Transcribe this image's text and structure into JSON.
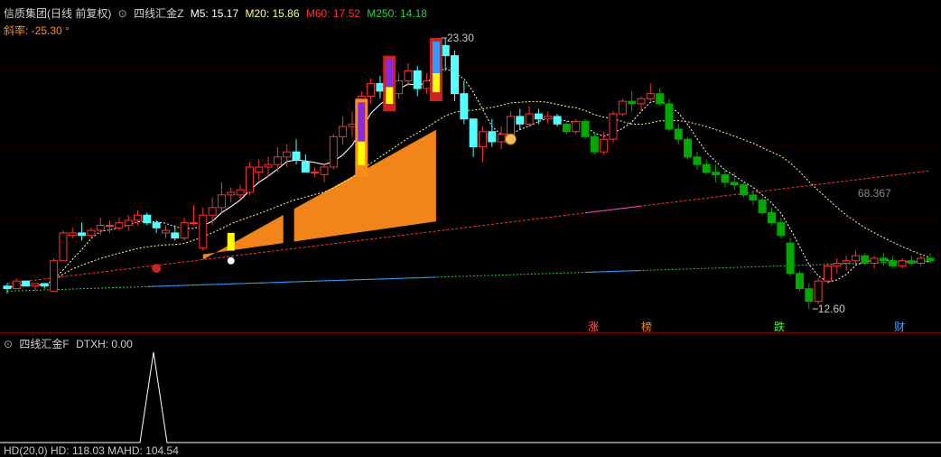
{
  "header": {
    "stock_title": "信质集团(日线 前复权)",
    "indicator_name": "四线汇金Z",
    "ma5_label": "M5: 15.17",
    "ma20_label": "M20: 15.86",
    "ma60_label": "M60: 17.52",
    "ma250_label": "M250: 14.18",
    "slope_label": "斜率: -25.30 °"
  },
  "sub_header": {
    "indicator_name": "四线汇金F",
    "dtxh_label": "DTXH: 0.00",
    "bottom_cut_text": "HD(20,0) HD: 118.03 MAHD: 104.54"
  },
  "annotations": {
    "high_label": "23.30",
    "low_label": "12.60",
    "ma_label": "68.367"
  },
  "signals": [
    "涨",
    "榜",
    "跌",
    "财"
  ],
  "colors": {
    "up": "#ff3232",
    "down": "#54ffff",
    "flat_down": "#00a800",
    "ma5": "#ffffff",
    "ma20": "#ffff80",
    "ma60": "#ff3232",
    "ma250": "#2ecc40",
    "accent_orange": "#ff8c1a",
    "slope_text": "#ff8c1a"
  },
  "chart_data": [
    {
      "type": "candlestick",
      "title": "四线汇金Z",
      "price_range": [
        12.6,
        23.3
      ],
      "series": [
        {
          "name": "M5",
          "value": 15.17
        },
        {
          "name": "M20",
          "value": 15.86
        },
        {
          "name": "M60",
          "value": 17.52
        },
        {
          "name": "M250",
          "value": 14.18
        }
      ],
      "ohlc": [
        [
          13.5,
          13.6,
          13.2,
          13.4
        ],
        [
          13.4,
          13.8,
          13.4,
          13.7
        ],
        [
          13.7,
          13.7,
          13.5,
          13.5
        ],
        [
          13.5,
          13.6,
          13.3,
          13.6
        ],
        [
          13.6,
          13.6,
          13.4,
          13.5
        ],
        [
          13.3,
          14.6,
          13.3,
          14.5
        ],
        [
          14.5,
          15.7,
          14.5,
          15.6
        ],
        [
          15.5,
          15.8,
          15.4,
          15.6
        ],
        [
          15.6,
          16.0,
          15.3,
          15.5
        ],
        [
          15.5,
          15.8,
          15.4,
          15.7
        ],
        [
          15.7,
          16.2,
          15.5,
          15.9
        ],
        [
          15.9,
          16.1,
          15.6,
          15.9
        ],
        [
          15.8,
          16.2,
          15.7,
          16.0
        ],
        [
          15.9,
          16.3,
          15.7,
          16.1
        ],
        [
          16.1,
          16.5,
          15.9,
          16.3
        ],
        [
          16.3,
          16.4,
          15.9,
          16.0
        ],
        [
          16.0,
          16.1,
          15.6,
          15.8
        ],
        [
          15.6,
          15.9,
          15.4,
          15.7
        ],
        [
          15.6,
          15.9,
          15.3,
          15.4
        ],
        [
          15.4,
          16.2,
          15.3,
          16.0
        ],
        [
          16.0,
          16.7,
          15.9,
          16.0
        ],
        [
          15.0,
          16.6,
          14.9,
          16.3
        ],
        [
          16.3,
          17.0,
          15.9,
          16.6
        ],
        [
          16.6,
          17.6,
          16.4,
          17.1
        ],
        [
          17.1,
          17.4,
          16.8,
          17.2
        ],
        [
          17.1,
          17.5,
          16.9,
          17.3
        ],
        [
          17.2,
          18.4,
          17.1,
          18.2
        ],
        [
          18.0,
          18.5,
          17.7,
          18.2
        ],
        [
          18.2,
          18.6,
          17.8,
          18.3
        ],
        [
          18.3,
          19.0,
          18.0,
          18.6
        ],
        [
          18.6,
          19.1,
          18.2,
          18.8
        ],
        [
          18.8,
          19.3,
          18.3,
          18.5
        ],
        [
          18.4,
          18.7,
          18.0,
          18.0
        ],
        [
          18.0,
          18.2,
          17.8,
          18.0
        ],
        [
          17.9,
          18.3,
          17.6,
          18.2
        ],
        [
          18.2,
          19.5,
          18.1,
          19.4
        ],
        [
          19.4,
          20.2,
          19.1,
          19.8
        ],
        [
          19.8,
          20.4,
          19.4,
          19.9
        ],
        [
          19.9,
          21.2,
          19.8,
          21.0
        ],
        [
          21.0,
          21.7,
          20.7,
          21.5
        ],
        [
          21.5,
          21.8,
          20.9,
          21.2
        ],
        [
          21.2,
          21.5,
          20.7,
          21.1
        ],
        [
          21.1,
          21.9,
          20.9,
          21.6
        ],
        [
          21.6,
          22.3,
          21.4,
          22.0
        ],
        [
          22.0,
          22.2,
          21.0,
          21.3
        ],
        [
          21.3,
          21.9,
          21.1,
          21.6
        ],
        [
          21.6,
          23.3,
          21.5,
          23.0
        ],
        [
          23.0,
          23.3,
          22.0,
          22.6
        ],
        [
          22.6,
          22.8,
          20.8,
          21.1
        ],
        [
          21.1,
          21.6,
          19.9,
          20.1
        ],
        [
          20.1,
          20.1,
          18.6,
          19.0
        ],
        [
          19.0,
          19.8,
          18.4,
          19.6
        ],
        [
          19.6,
          20.1,
          19.0,
          19.2
        ],
        [
          19.2,
          19.8,
          18.9,
          19.5
        ],
        [
          19.5,
          20.4,
          19.4,
          20.2
        ],
        [
          20.2,
          20.5,
          19.7,
          19.9
        ],
        [
          19.9,
          20.6,
          19.8,
          20.3
        ],
        [
          20.3,
          20.5,
          19.9,
          20.1
        ],
        [
          20.1,
          20.4,
          19.9,
          20.2
        ],
        [
          20.2,
          20.3,
          19.8,
          19.9
        ],
        [
          19.9,
          20.0,
          19.5,
          19.6
        ],
        [
          19.6,
          20.1,
          19.5,
          20.0
        ],
        [
          20.0,
          20.1,
          19.3,
          19.4
        ],
        [
          19.4,
          19.6,
          18.7,
          18.8
        ],
        [
          18.8,
          19.6,
          18.7,
          19.3
        ],
        [
          19.3,
          20.4,
          19.2,
          20.3
        ],
        [
          20.3,
          20.9,
          20.2,
          20.8
        ],
        [
          20.8,
          21.2,
          20.4,
          20.7
        ],
        [
          20.7,
          21.0,
          20.4,
          20.9
        ],
        [
          20.9,
          21.5,
          20.8,
          21.1
        ],
        [
          21.1,
          21.3,
          20.6,
          20.7
        ],
        [
          20.7,
          20.9,
          19.6,
          19.7
        ],
        [
          19.7,
          19.9,
          19.1,
          19.3
        ],
        [
          19.3,
          19.4,
          18.5,
          18.6
        ],
        [
          18.6,
          18.8,
          18.1,
          18.3
        ],
        [
          18.3,
          18.5,
          17.9,
          18.0
        ],
        [
          18.0,
          18.3,
          17.6,
          17.9
        ],
        [
          17.9,
          18.1,
          17.4,
          17.6
        ],
        [
          17.6,
          18.0,
          17.3,
          17.5
        ],
        [
          17.5,
          17.6,
          17.0,
          17.1
        ],
        [
          17.1,
          17.3,
          16.7,
          16.9
        ],
        [
          16.9,
          17.0,
          16.3,
          16.4
        ],
        [
          16.4,
          16.6,
          15.9,
          16.0
        ],
        [
          16.0,
          16.2,
          15.4,
          15.5
        ],
        [
          15.2,
          15.4,
          13.9,
          14.0
        ],
        [
          14.0,
          14.1,
          13.3,
          13.4
        ],
        [
          13.4,
          13.6,
          12.6,
          12.9
        ],
        [
          12.9,
          13.8,
          12.8,
          13.7
        ],
        [
          13.7,
          14.4,
          13.6,
          14.3
        ],
        [
          14.3,
          14.6,
          14.0,
          14.4
        ],
        [
          14.4,
          14.7,
          14.1,
          14.5
        ],
        [
          14.5,
          14.9,
          14.3,
          14.7
        ],
        [
          14.7,
          14.8,
          14.3,
          14.4
        ],
        [
          14.4,
          14.7,
          14.2,
          14.6
        ],
        [
          14.6,
          14.8,
          14.3,
          14.5
        ],
        [
          14.5,
          14.7,
          14.2,
          14.3
        ],
        [
          14.3,
          14.6,
          14.2,
          14.5
        ],
        [
          14.5,
          14.7,
          14.3,
          14.4
        ],
        [
          14.4,
          14.7,
          14.3,
          14.6
        ],
        [
          14.6,
          14.8,
          14.4,
          14.5
        ]
      ]
    },
    {
      "type": "line",
      "title": "四线汇金F",
      "series": [
        {
          "name": "DTXH",
          "value": 0.0
        }
      ]
    }
  ]
}
